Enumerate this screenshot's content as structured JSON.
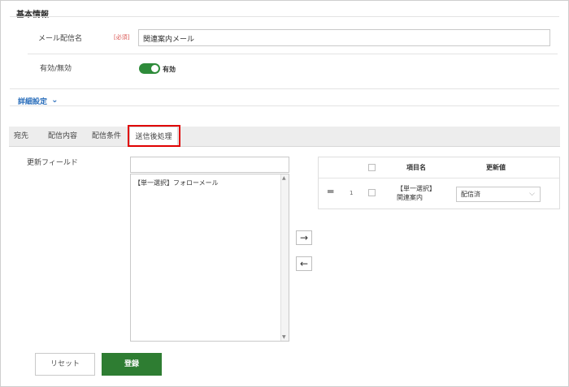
{
  "basic": {
    "title": "基本情報",
    "mail_name_label": "メール配信名",
    "required_badge": "[必須]",
    "mail_name_value": "関連案内メール",
    "enable_label": "有効/無効",
    "enable_state": "有効"
  },
  "details": {
    "title": "詳細設定",
    "chevron": "⌄"
  },
  "tabs": [
    "宛先",
    "配信内容",
    "配信条件",
    "送信後処理"
  ],
  "update_field": {
    "label": "更新フィールド",
    "search_value": "",
    "list_items": [
      "【単一選択】フォローメール"
    ]
  },
  "move": {
    "right": "→",
    "left": "←"
  },
  "table": {
    "col_item": "項目名",
    "col_value": "更新値",
    "rows": [
      {
        "handle": "═",
        "index": "1",
        "item_line1": "【単一選択】",
        "item_line2": "関連案内",
        "value": "配信済"
      }
    ]
  },
  "buttons": {
    "reset": "リセット",
    "submit": "登録"
  },
  "colors": {
    "accent": "#2e7d32",
    "highlight": "#e00000",
    "link": "#2a6ebb"
  }
}
